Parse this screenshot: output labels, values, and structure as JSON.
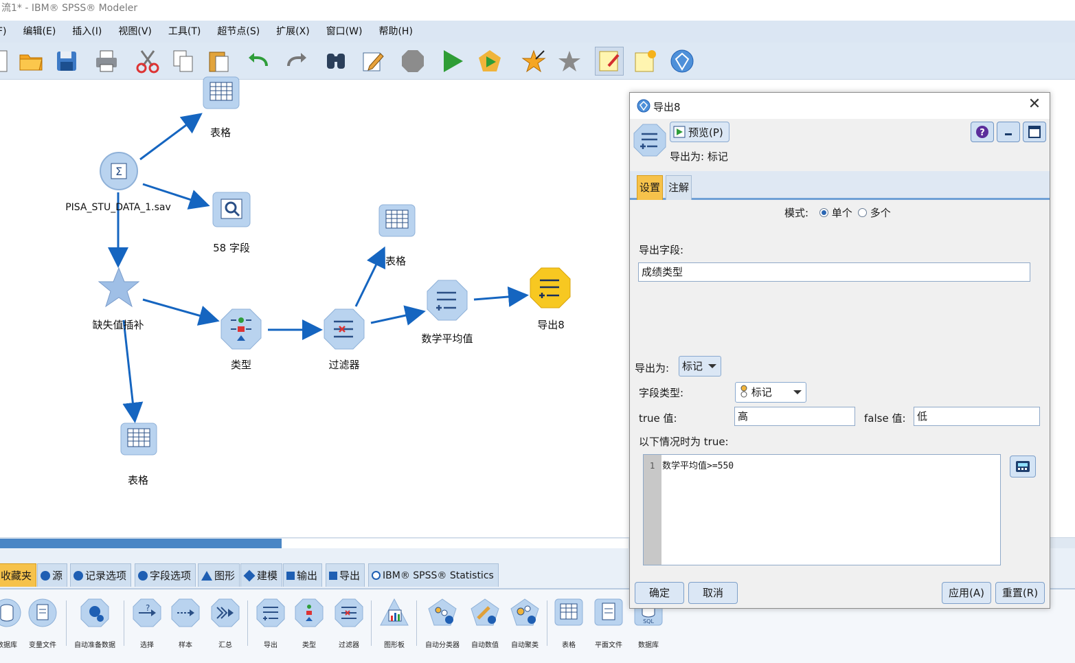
{
  "window": {
    "title": "流1* - IBM® SPSS® Modeler"
  },
  "menu": [
    "文件(F)",
    "编辑(E)",
    "插入(I)",
    "视图(V)",
    "工具(T)",
    "超节点(S)",
    "扩展(X)",
    "窗口(W)",
    "帮助(H)"
  ],
  "menu_visible": [
    "F)",
    "编辑(E)",
    "插入(I)",
    "视图(V)",
    "工具(T)",
    "超节点(S)",
    "扩展(X)",
    "窗口(W)",
    "帮助(H)"
  ],
  "toolbar": {
    "buttons": [
      "new-icon",
      "open-folder-icon",
      "save-icon",
      "print-icon",
      "cut-icon",
      "copy-icon",
      "paste-icon",
      "undo-icon",
      "redo-icon",
      "find-icon",
      "edit-icon",
      "stop-icon",
      "run-icon",
      "run-selection-icon",
      "add-favorite-icon",
      "favorites-icon",
      "annotate-icon",
      "new-annotation-icon",
      "model-icon"
    ]
  },
  "canvas": {
    "nodes": {
      "table_top": "表格",
      "source": "PISA_STU_DATA_1.sav",
      "fields58": "58 字段",
      "impute": "缺失值插补",
      "type": "类型",
      "filter": "过滤器",
      "table_mid": "表格",
      "derive": "数学平均值",
      "export8": "导出8",
      "table_bottom": "表格"
    }
  },
  "palette": {
    "tabs": [
      "收藏夹",
      "源",
      "记录选项",
      "字段选项",
      "图形",
      "建模",
      "输出",
      "导出",
      "IBM® SPSS® Statistics"
    ],
    "items": [
      "数据库",
      "变量文件",
      "自动准备数据",
      "选择",
      "样本",
      "汇总",
      "导出",
      "类型",
      "过滤器",
      "图形板",
      "自动分类器",
      "自动数值",
      "自动聚类",
      "表格",
      "平面文件",
      "数据库"
    ]
  },
  "dialog": {
    "title": "导出8",
    "preview_label": "预览(P)",
    "export_as_header": "导出为: 标记",
    "tabs": {
      "settings": "设置",
      "annotations": "注解"
    },
    "mode_label": "模式:",
    "mode_single": "单个",
    "mode_multiple": "多个",
    "export_field_label": "导出字段:",
    "export_field_value": "成绩类型",
    "export_as_label": "导出为:",
    "export_as_value": "标记",
    "field_type_label": "字段类型:",
    "field_type_value": "标记",
    "true_label": "true 值:",
    "true_value": "高",
    "false_label": "false 值:",
    "false_value": "低",
    "condition_label": "以下情况时为 true:",
    "line_number": "1",
    "expression": "数学平均值>=550",
    "ok": "确定",
    "cancel": "取消",
    "apply": "应用(A)",
    "reset": "重置(R)"
  },
  "colors": {
    "accent": "#1f5fb3",
    "tab_selected": "#f6c24b",
    "node_face": "#aac8ea",
    "export_node": "#f7c821",
    "link": "#1565c0"
  }
}
